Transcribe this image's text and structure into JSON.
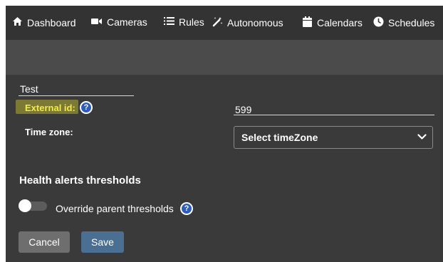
{
  "nav": {
    "items": [
      {
        "label": "Dashboard",
        "icon": "home-icon"
      },
      {
        "label": "Cameras",
        "icon": "video-camera-icon"
      },
      {
        "label": "Rules",
        "icon": "list-icon"
      },
      {
        "label": "Autonomous",
        "icon": "magic-wand-icon"
      },
      {
        "label": "Calendars",
        "icon": "calendar-icon"
      },
      {
        "label": "Schedules",
        "icon": "clock-icon"
      }
    ]
  },
  "form": {
    "name_value": "Test",
    "external_id_label": "External id:",
    "external_id_value": "599",
    "time_zone_label": "Time zone:",
    "time_zone_selected": "Select timeZone",
    "health_title": "Health alerts thresholds",
    "override_label": "Override parent thresholds",
    "override_enabled": false,
    "help_glyph": "?"
  },
  "buttons": {
    "cancel_label": "Cancel",
    "save_label": "Save"
  },
  "colors": {
    "accent": "#2e5cb8",
    "save_button": "#4a6f93",
    "highlight": "#f7f229"
  }
}
